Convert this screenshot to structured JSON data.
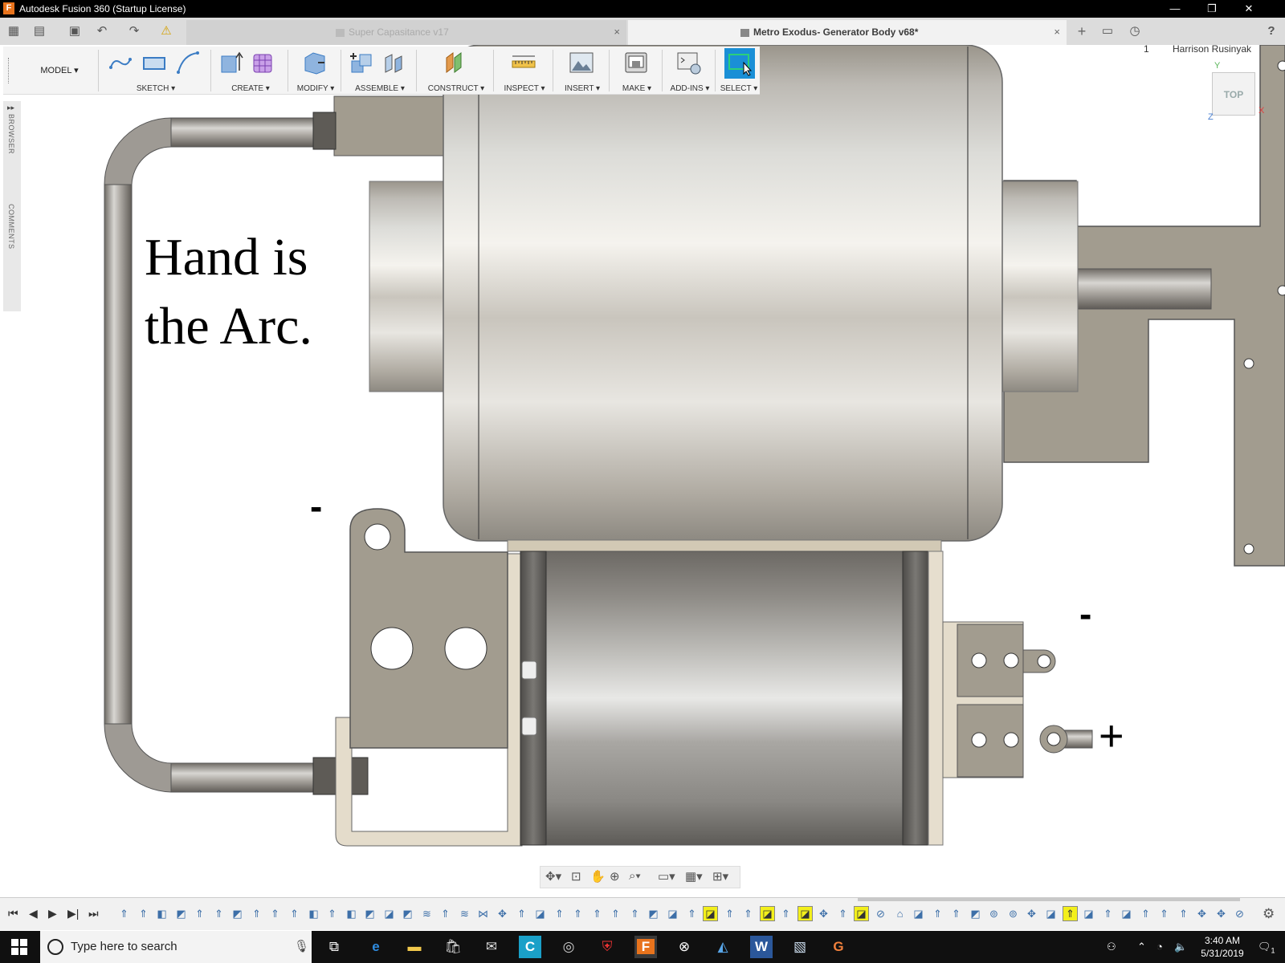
{
  "window": {
    "title": "Autodesk Fusion 360 (Startup License)",
    "app_icon": "F",
    "controls": [
      "—",
      "❐",
      "✕"
    ]
  },
  "tabs": {
    "inactive_title": "Super Capasitance v17",
    "active_title": "Metro Exodus- Generator Body v68*",
    "close_glyph": "×",
    "add_glyph": "+"
  },
  "header_right": {
    "job_count": "1",
    "user_name": "Harrison Rusinyak",
    "help_glyph": "?"
  },
  "toolbar": {
    "workspace": "MODEL",
    "groups": [
      {
        "label": "SKETCH ▾"
      },
      {
        "label": "CREATE ▾"
      },
      {
        "label": "MODIFY ▾"
      },
      {
        "label": "ASSEMBLE ▾"
      },
      {
        "label": "CONSTRUCT ▾"
      },
      {
        "label": "INSPECT ▾"
      },
      {
        "label": "INSERT ▾"
      },
      {
        "label": "MAKE ▾"
      },
      {
        "label": "ADD-INS ▾"
      },
      {
        "label": "SELECT ▾"
      }
    ]
  },
  "left_panel": {
    "browser": "BROWSER",
    "comments": "COMMENTS"
  },
  "viewcube": {
    "face": "TOP",
    "axis_y": "Y",
    "axis_x": "X",
    "axis_z": "Z"
  },
  "canvas": {
    "annotation_line1": "Hand is",
    "annotation_line2": "the Arc.",
    "minus_left": "-",
    "minus_right": "-",
    "plus_right": "+"
  },
  "timeline": {
    "highlighted_steps": [
      31,
      34,
      36,
      39,
      50
    ]
  },
  "taskbar": {
    "search_placeholder": "Type here to search",
    "time": "3:40 AM",
    "date": "5/31/2019",
    "notification_count": "1"
  }
}
